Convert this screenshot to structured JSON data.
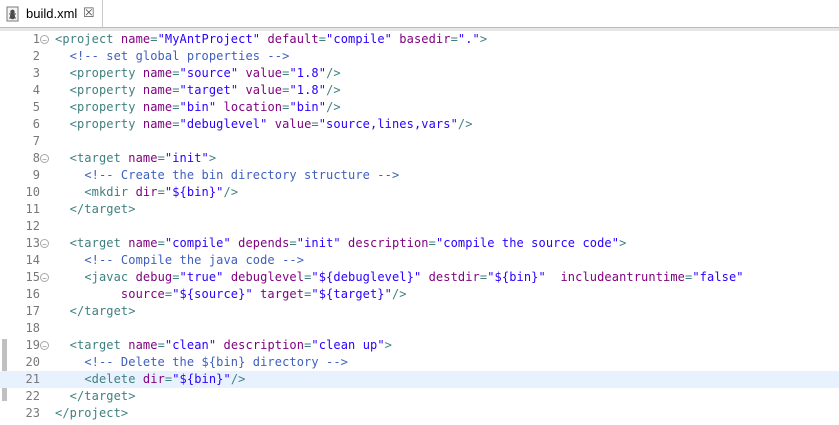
{
  "tab": {
    "title": "build.xml",
    "close_glyph": "☒",
    "icon": "ant-build-file-icon"
  },
  "lines": [
    {
      "n": "1",
      "fold": "⊖",
      "tokens": [
        [
          "t",
          "<project "
        ],
        [
          "a",
          "name"
        ],
        [
          "t",
          "="
        ],
        [
          "v",
          "\"MyAntProject\""
        ],
        [
          "t",
          " "
        ],
        [
          "a",
          "default"
        ],
        [
          "t",
          "="
        ],
        [
          "v",
          "\"compile\""
        ],
        [
          "t",
          " "
        ],
        [
          "a",
          "basedir"
        ],
        [
          "t",
          "="
        ],
        [
          "v",
          "\".\""
        ],
        [
          "t",
          ">"
        ]
      ]
    },
    {
      "n": "2",
      "tokens": [
        [
          "p",
          "  "
        ],
        [
          "c",
          "<!-- set global properties -->"
        ]
      ]
    },
    {
      "n": "3",
      "tokens": [
        [
          "p",
          "  "
        ],
        [
          "t",
          "<property "
        ],
        [
          "a",
          "name"
        ],
        [
          "t",
          "="
        ],
        [
          "v",
          "\"source\""
        ],
        [
          "t",
          " "
        ],
        [
          "a",
          "value"
        ],
        [
          "t",
          "="
        ],
        [
          "v",
          "\"1.8\""
        ],
        [
          "t",
          "/>"
        ]
      ]
    },
    {
      "n": "4",
      "tokens": [
        [
          "p",
          "  "
        ],
        [
          "t",
          "<property "
        ],
        [
          "a",
          "name"
        ],
        [
          "t",
          "="
        ],
        [
          "v",
          "\"target\""
        ],
        [
          "t",
          " "
        ],
        [
          "a",
          "value"
        ],
        [
          "t",
          "="
        ],
        [
          "v",
          "\"1.8\""
        ],
        [
          "t",
          "/>"
        ]
      ]
    },
    {
      "n": "5",
      "tokens": [
        [
          "p",
          "  "
        ],
        [
          "t",
          "<property "
        ],
        [
          "a",
          "name"
        ],
        [
          "t",
          "="
        ],
        [
          "v",
          "\"bin\""
        ],
        [
          "t",
          " "
        ],
        [
          "a",
          "location"
        ],
        [
          "t",
          "="
        ],
        [
          "v",
          "\"bin\""
        ],
        [
          "t",
          "/>"
        ]
      ]
    },
    {
      "n": "6",
      "tokens": [
        [
          "p",
          "  "
        ],
        [
          "t",
          "<property "
        ],
        [
          "a",
          "name"
        ],
        [
          "t",
          "="
        ],
        [
          "v",
          "\"debuglevel\""
        ],
        [
          "t",
          " "
        ],
        [
          "a",
          "value"
        ],
        [
          "t",
          "="
        ],
        [
          "v",
          "\"source,lines,vars\""
        ],
        [
          "t",
          "/>"
        ]
      ]
    },
    {
      "n": "7",
      "tokens": []
    },
    {
      "n": "8",
      "fold": "⊖",
      "tokens": [
        [
          "p",
          "  "
        ],
        [
          "t",
          "<target "
        ],
        [
          "a",
          "name"
        ],
        [
          "t",
          "="
        ],
        [
          "v",
          "\"init\""
        ],
        [
          "t",
          ">"
        ]
      ]
    },
    {
      "n": "9",
      "tokens": [
        [
          "p",
          "    "
        ],
        [
          "c",
          "<!-- Create the bin directory structure -->"
        ]
      ]
    },
    {
      "n": "10",
      "tokens": [
        [
          "p",
          "    "
        ],
        [
          "t",
          "<mkdir "
        ],
        [
          "a",
          "dir"
        ],
        [
          "t",
          "="
        ],
        [
          "v",
          "\"${bin}\""
        ],
        [
          "t",
          "/>"
        ]
      ]
    },
    {
      "n": "11",
      "tokens": [
        [
          "p",
          "  "
        ],
        [
          "t",
          "</target>"
        ]
      ]
    },
    {
      "n": "12",
      "tokens": []
    },
    {
      "n": "13",
      "fold": "⊖",
      "tokens": [
        [
          "p",
          "  "
        ],
        [
          "t",
          "<target "
        ],
        [
          "a",
          "name"
        ],
        [
          "t",
          "="
        ],
        [
          "v",
          "\"compile\""
        ],
        [
          "t",
          " "
        ],
        [
          "a",
          "depends"
        ],
        [
          "t",
          "="
        ],
        [
          "v",
          "\"init\""
        ],
        [
          "t",
          " "
        ],
        [
          "a",
          "description"
        ],
        [
          "t",
          "="
        ],
        [
          "v",
          "\"compile the source code\""
        ],
        [
          "t",
          ">"
        ]
      ]
    },
    {
      "n": "14",
      "tokens": [
        [
          "p",
          "    "
        ],
        [
          "c",
          "<!-- Compile the java code -->"
        ]
      ]
    },
    {
      "n": "15",
      "fold": "⊖",
      "tokens": [
        [
          "p",
          "    "
        ],
        [
          "t",
          "<javac "
        ],
        [
          "a",
          "debug"
        ],
        [
          "t",
          "="
        ],
        [
          "v",
          "\"true\""
        ],
        [
          "t",
          " "
        ],
        [
          "a",
          "debuglevel"
        ],
        [
          "t",
          "="
        ],
        [
          "v",
          "\"${debuglevel}\""
        ],
        [
          "t",
          " "
        ],
        [
          "a",
          "destdir"
        ],
        [
          "t",
          "="
        ],
        [
          "v",
          "\"${bin}\""
        ],
        [
          "t",
          "  "
        ],
        [
          "a",
          "includeantruntime"
        ],
        [
          "t",
          "="
        ],
        [
          "v",
          "\"false\""
        ]
      ]
    },
    {
      "n": "16",
      "tokens": [
        [
          "p",
          "         "
        ],
        [
          "a",
          "source"
        ],
        [
          "t",
          "="
        ],
        [
          "v",
          "\"${source}\""
        ],
        [
          "t",
          " "
        ],
        [
          "a",
          "target"
        ],
        [
          "t",
          "="
        ],
        [
          "v",
          "\"${target}\""
        ],
        [
          "t",
          "/>"
        ]
      ]
    },
    {
      "n": "17",
      "tokens": [
        [
          "p",
          "  "
        ],
        [
          "t",
          "</target>"
        ]
      ]
    },
    {
      "n": "18",
      "tokens": []
    },
    {
      "n": "19",
      "fold": "⊖",
      "tokens": [
        [
          "p",
          "  "
        ],
        [
          "t",
          "<target "
        ],
        [
          "a",
          "name"
        ],
        [
          "t",
          "="
        ],
        [
          "v",
          "\"clean\""
        ],
        [
          "t",
          " "
        ],
        [
          "a",
          "description"
        ],
        [
          "t",
          "="
        ],
        [
          "v",
          "\"clean up\""
        ],
        [
          "t",
          ">"
        ]
      ]
    },
    {
      "n": "20",
      "tokens": [
        [
          "p",
          "    "
        ],
        [
          "c",
          "<!-- Delete the ${bin} directory -->"
        ]
      ]
    },
    {
      "n": "21",
      "current": true,
      "tokens": [
        [
          "p",
          "    "
        ],
        [
          "t",
          "<delete "
        ],
        [
          "a",
          "dir"
        ],
        [
          "t",
          "="
        ],
        [
          "v",
          "\"${bin}\""
        ],
        [
          "t",
          "/>"
        ]
      ]
    },
    {
      "n": "22",
      "tokens": [
        [
          "p",
          "  "
        ],
        [
          "t",
          "</target>"
        ]
      ]
    },
    {
      "n": "23",
      "tokens": [
        [
          "t",
          "</project>"
        ]
      ]
    }
  ],
  "colors": {
    "tag": "#3f7f7f",
    "attribute": "#7f007f",
    "value": "#2a00ff",
    "comment": "#3f5fbf",
    "current_line": "#e8f2fe"
  }
}
